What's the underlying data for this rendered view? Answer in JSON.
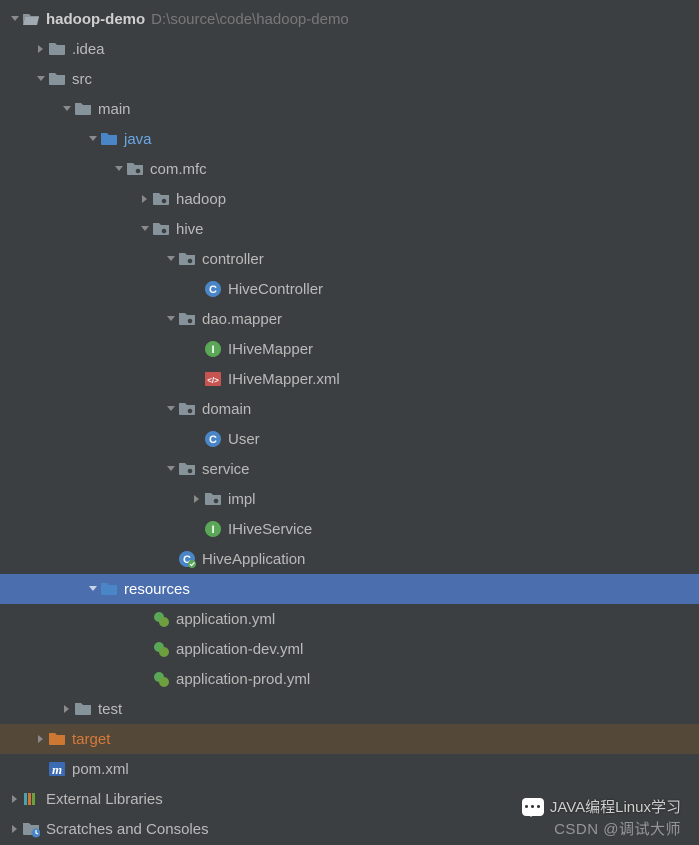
{
  "root": {
    "name": "hadoop-demo",
    "path": "D:\\source\\code\\hadoop-demo"
  },
  "idea": ".idea",
  "src": "src",
  "main": "main",
  "java": "java",
  "pkg_mfc": "com.mfc",
  "pkg_hadoop": "hadoop",
  "pkg_hive": "hive",
  "pkg_controller": "controller",
  "cls_hivecontroller": "HiveController",
  "pkg_daomapper": "dao.mapper",
  "if_ihivemapper": "IHiveMapper",
  "file_ihivemapper_xml": "IHiveMapper.xml",
  "pkg_domain": "domain",
  "cls_user": "User",
  "pkg_service": "service",
  "pkg_impl": "impl",
  "if_ihiveservice": "IHiveService",
  "cls_hiveapp": "HiveApplication",
  "resources": "resources",
  "yml_app": "application.yml",
  "yml_dev": "application-dev.yml",
  "yml_prod": "application-prod.yml",
  "test": "test",
  "target": "target",
  "pom": "pom.xml",
  "ext_lib": "External Libraries",
  "scratches": "Scratches and Consoles",
  "credit_wechat": "JAVA编程Linux学习",
  "credit_csdn": "CSDN @调试大师"
}
